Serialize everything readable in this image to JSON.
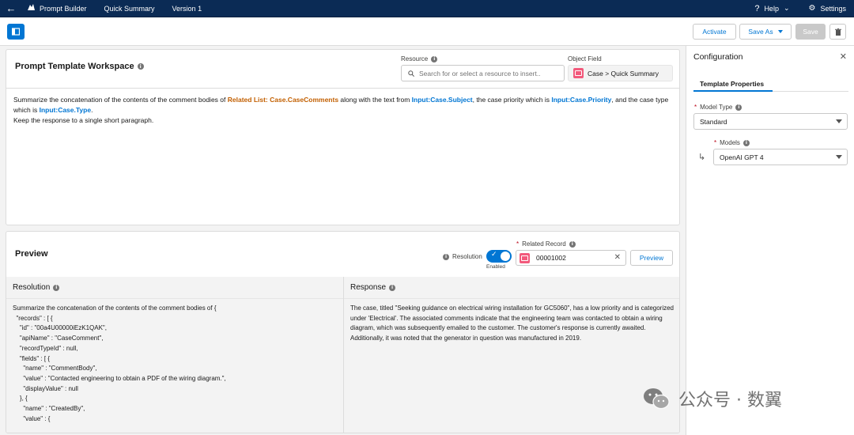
{
  "topbar": {
    "nav": [
      "Prompt Builder",
      "Quick Summary",
      "Version 1"
    ],
    "help_label": "Help",
    "settings_label": "Settings"
  },
  "toolbar": {
    "activate_label": "Activate",
    "save_as_label": "Save As",
    "save_label": "Save"
  },
  "workspace": {
    "title": "Prompt Template Workspace",
    "resource_label": "Resource",
    "resource_placeholder": "Search for or select a resource to insert..",
    "object_field_label": "Object Field",
    "object_field_value": "Case > Quick Summary",
    "prompt": {
      "t1": "Summarize the concatenation of the contents of the comment bodies of ",
      "m1": "Related List: Case.CaseComments",
      "t2": " along with the text from ",
      "m2": "Input:Case.Subject",
      "t3": ", the case priority which is ",
      "m3": "Input:Case.Priority",
      "t4": ", and the case type which is ",
      "m4": "Input:Case.Type",
      "t5": ".",
      "line2": "Keep the response to a single short paragraph."
    }
  },
  "preview": {
    "title": "Preview",
    "resolution_label": "Resolution",
    "toggle_state": "Enabled",
    "related_record_label": "Related Record",
    "related_record_value": "00001002",
    "preview_button": "Preview",
    "resolution_heading": "Resolution",
    "response_heading": "Response",
    "resolution_text": "Summarize the concatenation of the contents of the comment bodies of {\n  \"records\" : [ {\n    \"id\" : \"00a4U00000iEzK1QAK\",\n    \"apiName\" : \"CaseComment\",\n    \"recordTypeId\" : null,\n    \"fields\" : [ {\n      \"name\" : \"CommentBody\",\n      \"value\" : \"Contacted engineering to obtain a PDF of the wiring diagram.\",\n      \"displayValue\" : null\n    }, {\n      \"name\" : \"CreatedBy\",\n      \"value\" : {",
    "response_text": "The case, titled \"Seeking guidance on electrical wiring installation for GC5060\", has a low priority and is categorized under 'Electrical'. The associated comments indicate that the engineering team was contacted to obtain a wiring diagram, which was subsequently emailed to the customer. The customer's response is currently awaited. Additionally, it was noted that the generator in question was manufactured in 2019."
  },
  "config": {
    "title": "Configuration",
    "tab_label": "Template Properties",
    "model_type_label": "Model Type",
    "model_type_value": "Standard",
    "models_label": "Models",
    "models_value": "OpenAI GPT 4"
  },
  "watermark": {
    "text": "公众号 · 数翼"
  },
  "colors": {
    "nav_bg": "#0b2b55",
    "brand_blue": "#0176d3",
    "merge_field_orange": "#c25f00",
    "object_badge": "#f2597b"
  }
}
